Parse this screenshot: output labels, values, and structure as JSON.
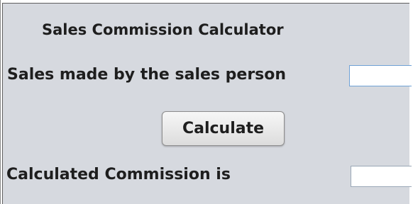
{
  "app": {
    "title": "Sales Commission Calculator"
  },
  "form": {
    "sales_label": "Sales made by the sales person",
    "sales_value": "",
    "calculate_label": "Calculate",
    "commission_label": "Calculated Commission is",
    "commission_value": ""
  },
  "colors": {
    "panel_bg": "#d6d9df",
    "focus_border": "#6fa2d6"
  }
}
